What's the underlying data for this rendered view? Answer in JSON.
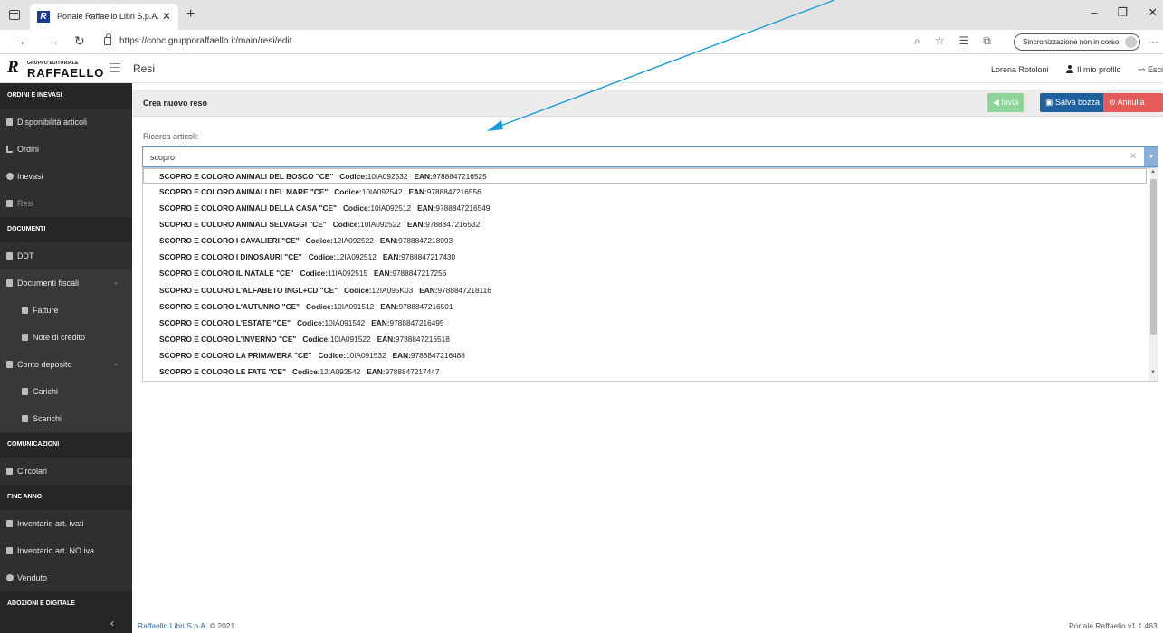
{
  "browser": {
    "tab_title": "Portale Raffaello Libri S.p.A.",
    "tab_favicon": "R",
    "url": "https://conc.grupporaffaello.it/main/resi/edit",
    "sync_label": "Sincronizzazione non in corso"
  },
  "header": {
    "logo_small": "GRUPPO EDITORIALE",
    "logo_big": "RAFFAELLO",
    "logo_mark": "R",
    "title": "Resi",
    "user_name": "Lorena Rotoloni",
    "profile_label": "Il mio profilo",
    "logout_label": "Esci"
  },
  "sidebar": {
    "sections": [
      {
        "title": "ORDINI E INEVASI",
        "items": [
          {
            "label": "Disponibilità articoli",
            "icon": "list-icon"
          },
          {
            "label": "Ordini",
            "icon": "cart-icon"
          },
          {
            "label": "Inevasi",
            "icon": "alert-icon"
          },
          {
            "label": "Resi",
            "icon": "undo-icon",
            "active": true
          }
        ]
      },
      {
        "title": "DOCUMENTI",
        "items": [
          {
            "label": "DDT",
            "icon": "file-icon"
          },
          {
            "label": "Documenti fiscali",
            "icon": "file-icon",
            "caret": "⌄"
          },
          {
            "label": "Fatture",
            "icon": "file-icon",
            "sub": true
          },
          {
            "label": "Note di credito",
            "icon": "file-icon",
            "sub": true
          },
          {
            "label": "Conto deposito",
            "icon": "file-icon",
            "caret": "⌄"
          },
          {
            "label": "Carichi",
            "icon": "file-icon",
            "sub": true
          },
          {
            "label": "Scarichi",
            "icon": "file-icon",
            "sub": true
          }
        ]
      },
      {
        "title": "COMUNICAZIONI",
        "items": [
          {
            "label": "Circolari",
            "icon": "envelope-icon"
          }
        ]
      },
      {
        "title": "FINE ANNO",
        "items": [
          {
            "label": "Inventario art. ivati",
            "icon": "database-icon"
          },
          {
            "label": "Inventario art. NO iva",
            "icon": "database-icon"
          },
          {
            "label": "Venduto",
            "icon": "coins-icon"
          }
        ]
      },
      {
        "title": "ADOZIONI E DIGITALE",
        "items": []
      }
    ],
    "collapse_glyph": "‹"
  },
  "main": {
    "title": "Crea nuovo reso",
    "buttons": {
      "send": "Invia",
      "save_draft": "Salva bozza",
      "cancel": "Annulla"
    },
    "search": {
      "label": "Ricerca articoli:",
      "value": "scopro"
    },
    "code_label": "Codice:",
    "ean_label": "EAN:",
    "results": [
      {
        "title": "SCOPRO E COLORO ANIMALI DEL BOSCO \"CE\"",
        "code": "10IA092532",
        "ean": "9788847216525"
      },
      {
        "title": "SCOPRO E COLORO ANIMALI DEL MARE \"CE\"",
        "code": "10IA092542",
        "ean": "9788847216556"
      },
      {
        "title": "SCOPRO E COLORO ANIMALI DELLA CASA \"CE\"",
        "code": "10IA092512",
        "ean": "9788847216549"
      },
      {
        "title": "SCOPRO E COLORO ANIMALI SELVAGGI \"CE\"",
        "code": "10IA092522",
        "ean": "9788847216532"
      },
      {
        "title": "SCOPRO E COLORO I CAVALIERI \"CE\"",
        "code": "12IA092522",
        "ean": "9788847218093"
      },
      {
        "title": "SCOPRO E COLORO I DINOSAURI \"CE\"",
        "code": "12IA092512",
        "ean": "9788847217430"
      },
      {
        "title": "SCOPRO E COLORO IL NATALE \"CE\"",
        "code": "11IA092515",
        "ean": "9788847217256"
      },
      {
        "title": "SCOPRO E COLORO L'ALFABETO INGL+CD \"CE\"",
        "code": "12IA095K03",
        "ean": "9788847218116"
      },
      {
        "title": "SCOPRO E COLORO L'AUTUNNO \"CE\"",
        "code": "10IA091512",
        "ean": "9788847216501"
      },
      {
        "title": "SCOPRO E COLORO L'ESTATE \"CE\"",
        "code": "10IA091542",
        "ean": "9788847216495"
      },
      {
        "title": "SCOPRO E COLORO L'INVERNO \"CE\"",
        "code": "10IA091522",
        "ean": "9788847216518"
      },
      {
        "title": "SCOPRO E COLORO LA PRIMAVERA \"CE\"",
        "code": "10IA091532",
        "ean": "9788847216488"
      },
      {
        "title": "SCOPRO E COLORO LE FATE \"CE\"",
        "code": "12IA092542",
        "ean": "9788847217447"
      }
    ]
  },
  "footer": {
    "company": "Raffaello Libri S.p.A.",
    "copyright": "© 2021",
    "version": "Portale Raffaello v1.1.463"
  },
  "colors": {
    "sidebar_bg": "#2f2f2f",
    "btn_send": "#8ed39a",
    "btn_save": "#1f5f9c",
    "btn_cancel": "#e55a5a",
    "annotation_arrow": "#1a9ad6"
  }
}
